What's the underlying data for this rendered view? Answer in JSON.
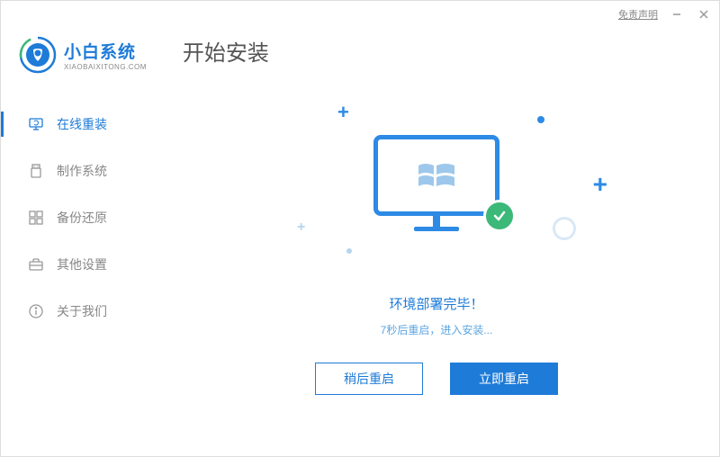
{
  "titlebar": {
    "disclaimer": "免责声明"
  },
  "brand": {
    "name": "小白系统",
    "url": "XIAOBAIXITONG.COM"
  },
  "page_title": "开始安装",
  "sidebar": {
    "items": [
      {
        "label": "在线重装",
        "icon": "computer-refresh"
      },
      {
        "label": "制作系统",
        "icon": "usb"
      },
      {
        "label": "备份还原",
        "icon": "grid"
      },
      {
        "label": "其他设置",
        "icon": "briefcase"
      },
      {
        "label": "关于我们",
        "icon": "info"
      }
    ]
  },
  "status": {
    "title": "环境部署完毕！",
    "subtitle": "7秒后重启，进入安装..."
  },
  "buttons": {
    "later": "稍后重启",
    "now": "立即重启"
  }
}
